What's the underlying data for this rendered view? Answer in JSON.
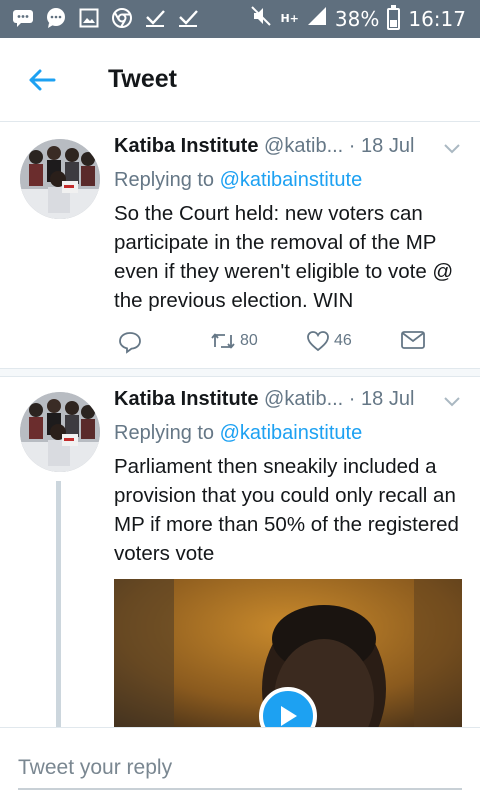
{
  "status_bar": {
    "battery": "38%",
    "time": "16:17",
    "network": "H+",
    "icons": [
      "chat-icon",
      "message-icon",
      "image-icon",
      "chrome-icon",
      "check-icon",
      "check-icon",
      "mute-icon",
      "signal-icon",
      "battery-icon"
    ]
  },
  "header": {
    "back_icon": "back-arrow-icon",
    "title": "Tweet"
  },
  "tweets": [
    {
      "name": "Katiba Institute",
      "handle": "@katib...",
      "date": "· 18 Jul",
      "replying_prefix": "Replying to",
      "replying_handle": "@katibainstitute",
      "text": "So the Court held: new voters can participate in the removal of the MP even if they weren't eligible to vote @ the previous election. WIN",
      "retweets": "80",
      "likes": "46"
    },
    {
      "name": "Katiba Institute",
      "handle": "@katib...",
      "date": "· 18 Jul",
      "replying_prefix": "Replying to",
      "replying_handle": "@katibainstitute",
      "text": "Parliament then sneakily included a provision that you could only recall an MP if more than 50% of the registered voters vote",
      "media": "video"
    }
  ],
  "reply_bar": {
    "placeholder": "Tweet your reply"
  },
  "colors": {
    "accent": "#1da1f2",
    "status_bar": "#5f6f7e",
    "secondary_text": "#657786"
  }
}
